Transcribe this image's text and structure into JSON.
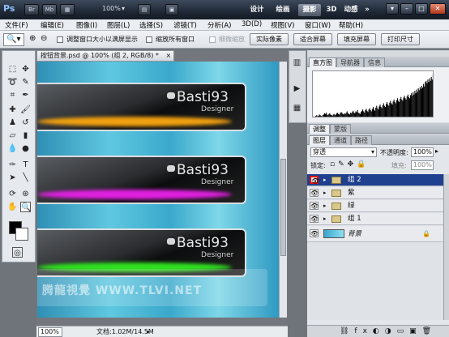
{
  "app": {
    "logo": "Ps"
  },
  "titlebar": {
    "buttons": [
      "Br",
      "Mb"
    ],
    "zoom": "100%",
    "workspaces": [
      {
        "label": "设计",
        "active": false
      },
      {
        "label": "绘画",
        "active": false
      },
      {
        "label": "摄影",
        "active": true
      },
      {
        "label": "3D",
        "active": false
      },
      {
        "label": "动感",
        "active": false
      }
    ],
    "more": "»"
  },
  "menu": [
    "文件(F)",
    "编辑(E)",
    "图像(I)",
    "图层(L)",
    "选择(S)",
    "滤镜(T)",
    "分析(A)",
    "3D(D)",
    "视图(V)",
    "窗口(W)",
    "帮助(H)"
  ],
  "options": {
    "checks": [
      {
        "label": "调整窗口大小以满屏显示",
        "checked": false,
        "dim": false
      },
      {
        "label": "缩放所有窗口",
        "checked": false,
        "dim": false
      },
      {
        "label": "细微缩放",
        "checked": false,
        "dim": true
      }
    ],
    "buttons": [
      "实际像素",
      "适合屏幕",
      "填充屏幕",
      "打印尺寸"
    ]
  },
  "document": {
    "tab_title": "按钮背景.psd @ 100% (组 2, RGB/8) *",
    "close": "×",
    "banners": [
      {
        "name": "Basti93",
        "sub": "Designer",
        "glow": "#f0a010"
      },
      {
        "name": "Basti93",
        "sub": "Designer",
        "glow": "#e020e0"
      },
      {
        "name": "Basti93",
        "sub": "Designer",
        "glow": "#30e020"
      }
    ],
    "watermark": "腾龍視覺 WWW.TLVI.NET",
    "status_zoom": "100%",
    "status_doc": "文档:1.02M/14.5M"
  },
  "panels": {
    "top_tabs": [
      {
        "label": "直方图",
        "active": true
      },
      {
        "label": "导航器",
        "active": false
      },
      {
        "label": "信息",
        "active": false
      }
    ],
    "mid_tabs": [
      {
        "label": "调整",
        "active": true
      },
      {
        "label": "蒙版",
        "active": false
      }
    ],
    "layer_tabs": [
      {
        "label": "图层",
        "active": true
      },
      {
        "label": "通道",
        "active": false
      },
      {
        "label": "路径",
        "active": false
      }
    ],
    "blend_mode": "穿透",
    "opacity_label": "不透明度:",
    "opacity": "100%",
    "lock_label": "锁定:",
    "fill_label": "填充:",
    "fill": "100%",
    "histogram": [
      2,
      3,
      2,
      4,
      5,
      3,
      4,
      6,
      5,
      4,
      3,
      5,
      6,
      8,
      7,
      9,
      6,
      5,
      7,
      8,
      6,
      5,
      4,
      6,
      7,
      5,
      6,
      8,
      9,
      7,
      6,
      8,
      10,
      9,
      7,
      6,
      8,
      7,
      9,
      11,
      8,
      7,
      6,
      9,
      8,
      10,
      12,
      9,
      8,
      11,
      10,
      13,
      9,
      8,
      7,
      10,
      12,
      14,
      11,
      9,
      13,
      15,
      12,
      10,
      14,
      16,
      13,
      11,
      15,
      18,
      14,
      12,
      17,
      20,
      16,
      14,
      19,
      22,
      18,
      16,
      21,
      24,
      20,
      18,
      23,
      26,
      22,
      20,
      25,
      28,
      24,
      22,
      27,
      30,
      26,
      24,
      29,
      32,
      28,
      26,
      31,
      34,
      30,
      28,
      33,
      36,
      32,
      30,
      35,
      38,
      34,
      32,
      37,
      40,
      36,
      42,
      38,
      44,
      40,
      46,
      42,
      48,
      45,
      50,
      47,
      52,
      49,
      55,
      51,
      58,
      60,
      56,
      62,
      58,
      64,
      60,
      66,
      62,
      70,
      58
    ],
    "layers": [
      {
        "name": "组 2",
        "type": "group",
        "selected": true
      },
      {
        "name": "紫",
        "type": "group",
        "selected": false
      },
      {
        "name": "绿",
        "type": "group",
        "selected": false
      },
      {
        "name": "组 1",
        "type": "group",
        "selected": false
      },
      {
        "name": "背景",
        "type": "image",
        "selected": false
      }
    ]
  },
  "colors": {
    "accent": "#1f3f8f",
    "titlebar": "#1f2836"
  }
}
